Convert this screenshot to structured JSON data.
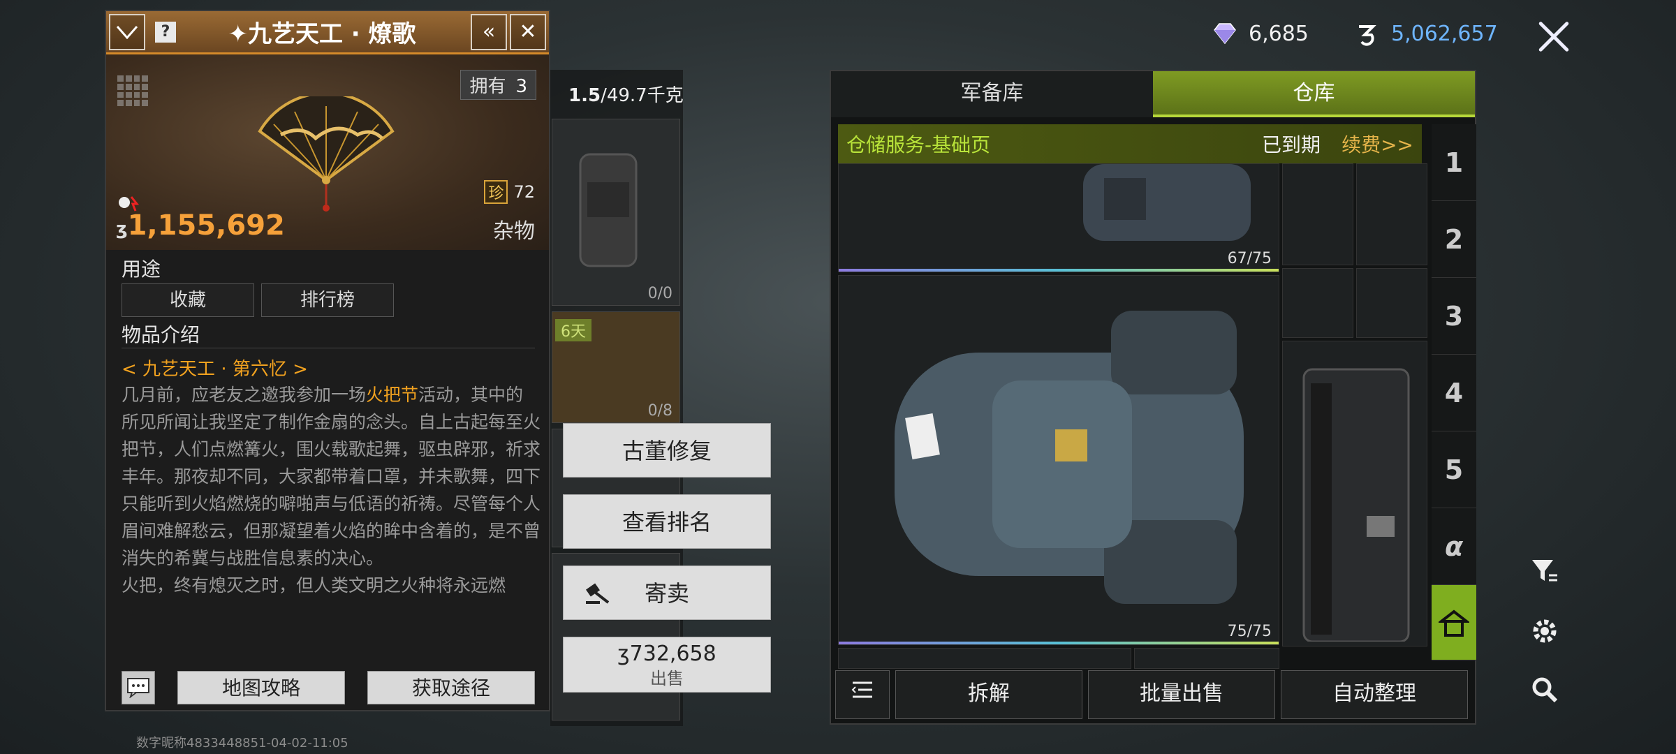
{
  "currency": {
    "gems": "6,685",
    "coins": "5,062,657"
  },
  "item": {
    "title": "九艺天工 · 燎歌",
    "owned_label": "拥有",
    "owned_count": "3",
    "price": "1,155,692",
    "rarity_badge": "珍",
    "rarity_value": "72",
    "category": "杂物",
    "use_label": "用途",
    "use_buttons": [
      "收藏",
      "排行榜"
    ],
    "intro_label": "物品介绍",
    "chapter": "< 九艺天工 · 第六忆 >",
    "desc_1": "几月前，应老友之邀我参加一场",
    "desc_hl": "火把节",
    "desc_2": "活动，其中的所见所闻让我坚定了制作金扇的念头。自上古起每至火把节，人们点燃篝火，围火载歌起舞，驱虫辟邪，祈求丰年。那夜却不同，大家都带着口罩，并未歌舞，四下只能听到火焰燃烧的噼啪声与低语的祈祷。尽管每个人眉间难解愁云，但那凝望着火焰的眸中含着的，是不曾消失的希冀与战胜信息素的决心。",
    "desc_3": "火把，终有熄灭之时，但人类文明之火种将永远燃",
    "map_btn": "地图攻略",
    "source_btn": "获取途径"
  },
  "watermark": "数字昵称4833448851-04-02-11:05",
  "weight": {
    "current": "1.5",
    "max": "/49.7千克"
  },
  "mid_slots": [
    {
      "count": "0/0"
    },
    {
      "count": "0/8",
      "tag": "6天"
    }
  ],
  "context_menu": {
    "repair": "古董修复",
    "rank": "查看排名",
    "consign": "寄卖",
    "sell_price": "732,658",
    "sell_label": "出售"
  },
  "warehouse": {
    "tabs": [
      "军备库",
      "仓库"
    ],
    "service_title": "仓储服务-基础页",
    "service_status": "已到期",
    "service_renew": "续费>>",
    "bag1_count": "67/75",
    "bag2_count": "75/75",
    "side_tabs": [
      "1",
      "2",
      "3",
      "4",
      "5",
      "α"
    ],
    "footer": [
      "拆解",
      "批量出售",
      "自动整理"
    ]
  },
  "colors": {
    "accent_green": "#7fae1f",
    "accent_orange": "#f2a21f",
    "coin_blue": "#6fb6ff"
  }
}
